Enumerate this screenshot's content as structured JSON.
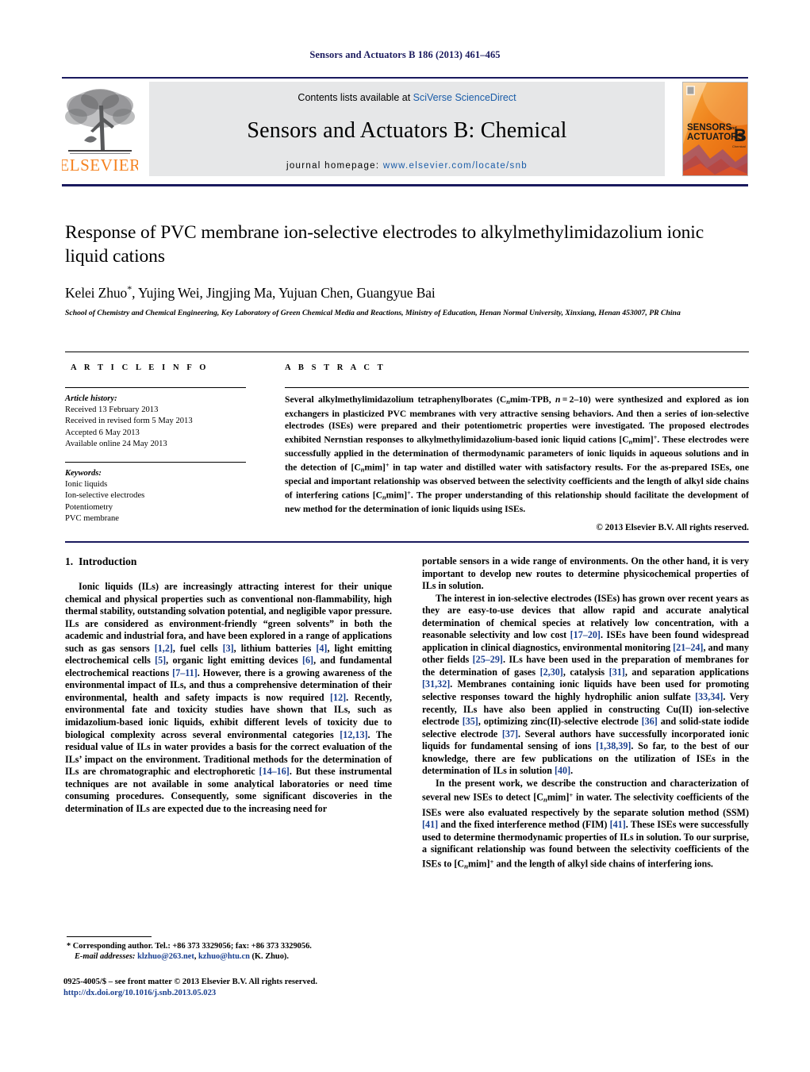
{
  "running_head": "Sensors and Actuators B 186 (2013) 461–465",
  "masthead": {
    "contents_prefix": "Contents lists available at ",
    "sciencedirect": "SciVerse ScienceDirect",
    "journal_title": "Sensors and Actuators B: Chemical",
    "homepage_label": "journal homepage:",
    "homepage_url": "www.elsevier.com/locate/snb",
    "publisher_logo_text": "ELSEVIER",
    "cover": {
      "line1": "SENSORS",
      "line1_small": "and",
      "line2": "ACTUATORS",
      "volume_letter": "B",
      "volume_sub": "Chemical"
    },
    "colors": {
      "rule": "#1a1a5e",
      "banner_bg": "#e6e7e8",
      "link": "#1a5ca8",
      "elsevier_orange": "#f58220",
      "cover_orange": "#f08a1e"
    }
  },
  "article": {
    "title": "Response of PVC membrane ion-selective electrodes to alkylmethylimidazolium ionic liquid cations",
    "authors": "Kelei Zhuo, Yujing Wei, Jingjing Ma, Yujuan Chen, Guangyue Bai",
    "corresponding_marker": "*",
    "affiliation": "School of Chemistry and Chemical Engineering, Key Laboratory of Green Chemical Media and Reactions, Ministry of Education, Henan Normal University, Xinxiang, Henan 453007, PR China"
  },
  "article_info": {
    "heading": "A R T I C L E   I N F O",
    "history_label": "Article history:",
    "history": [
      "Received 13 February 2013",
      "Received in revised form 5 May 2013",
      "Accepted 6 May 2013",
      "Available online 24 May 2013"
    ],
    "keywords_label": "Keywords:",
    "keywords": [
      "Ionic liquids",
      "Ion-selective electrodes",
      "Potentiometry",
      "PVC membrane"
    ]
  },
  "abstract": {
    "heading": "A B S T R A C T",
    "copyright": "© 2013 Elsevier B.V. All rights reserved."
  },
  "introduction": {
    "number": "1.",
    "heading": "Introduction"
  },
  "footnote": {
    "corresponding": "* Corresponding author. Tel.: +86 373 3329056; fax: +86 373 3329056.",
    "email_label": "E-mail addresses:",
    "email1": "klzhuo@263.net",
    "email2": "kzhuo@htu.cn",
    "email_suffix": "(K. Zhuo)."
  },
  "imprint": {
    "issn_line": "0925-4005/$ – see front matter © 2013 Elsevier B.V. All rights reserved.",
    "doi": "http://dx.doi.org/10.1016/j.snb.2013.05.023"
  }
}
